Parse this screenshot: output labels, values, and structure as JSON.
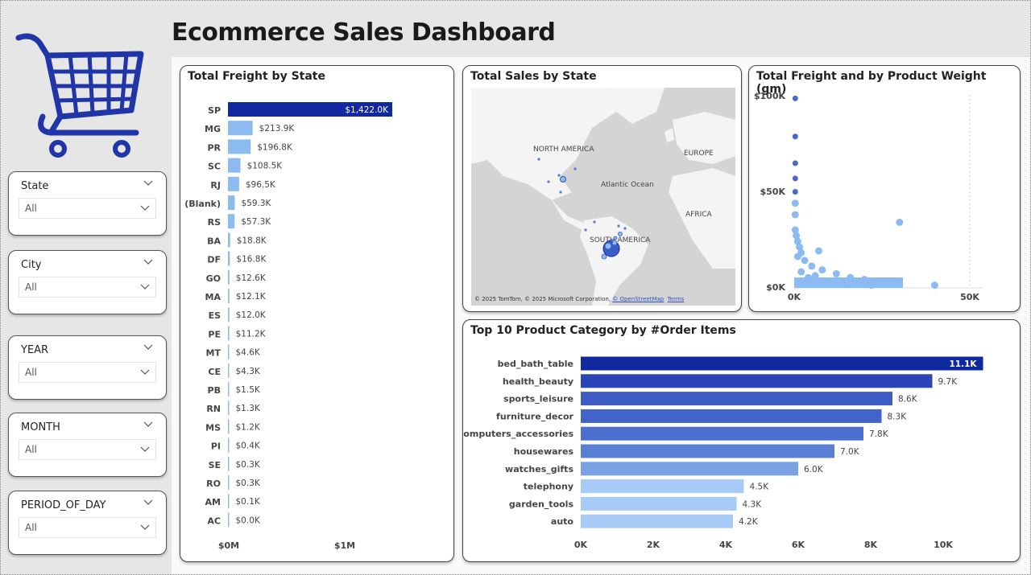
{
  "title": "Ecommerce Sales Dashboard",
  "colors": {
    "dark_blue": "#1129a0",
    "mid_blue": "#4a67cc",
    "light_blue": "#8bbbf0",
    "pale_blue": "#a7cbf6",
    "cart_blue": "#1f35a8"
  },
  "slicers": [
    {
      "label": "State",
      "value": "All"
    },
    {
      "label": "City",
      "value": "All"
    },
    {
      "label": "YEAR",
      "value": "All"
    },
    {
      "label": "MONTH",
      "value": "All"
    },
    {
      "label": "PERIOD_OF_DAY",
      "value": "All"
    }
  ],
  "freight_by_state": {
    "title": "Total Freight by State",
    "chart_data": {
      "type": "bar",
      "orientation": "horizontal",
      "categories": [
        "SP",
        "MG",
        "PR",
        "SC",
        "RJ",
        "(Blank)",
        "RS",
        "BA",
        "DF",
        "GO",
        "MA",
        "ES",
        "PE",
        "MT",
        "CE",
        "PB",
        "RN",
        "MS",
        "PI",
        "SE",
        "RO",
        "AM",
        "AC"
      ],
      "values": [
        1422.0,
        213.9,
        196.8,
        108.5,
        96.5,
        59.3,
        57.3,
        18.8,
        16.8,
        12.6,
        12.1,
        12.0,
        11.2,
        4.6,
        4.3,
        1.5,
        1.3,
        1.2,
        0.4,
        0.3,
        0.3,
        0.1,
        0.0
      ],
      "value_unit": "$K",
      "labels": [
        "$1,422.0K",
        "$213.9K",
        "$196.8K",
        "$108.5K",
        "$96.5K",
        "$59.3K",
        "$57.3K",
        "$18.8K",
        "$16.8K",
        "$12.6K",
        "$12.1K",
        "$12.0K",
        "$11.2K",
        "$4.6K",
        "$4.3K",
        "$1.5K",
        "$1.3K",
        "$1.2K",
        "$0.4K",
        "$0.3K",
        "$0.3K",
        "$0.1K",
        "$0.0K"
      ],
      "x_ticks": [
        "$0M",
        "$1M"
      ],
      "xlim": [
        0,
        1500
      ]
    }
  },
  "sales_by_state": {
    "title": "Total Sales by State",
    "labels": {
      "north_america": "NORTH AMERICA",
      "europe": "EUROPE",
      "atlantic": "Atlantic Ocean",
      "africa": "AFRICA",
      "south_america": "SOUTH AMERICA"
    },
    "credit": "© 2025 TomTom, © 2025 Microsoft Corporation,",
    "credit_link": "© OpenStreetMap",
    "terms": "Terms"
  },
  "freight_by_weight": {
    "title": "Total Freight and by Product Weight (gm)",
    "chart_data": {
      "type": "scatter",
      "y_ticks": [
        "$100K",
        "$50K",
        "$0K"
      ],
      "x_ticks": [
        "0K",
        "50K"
      ],
      "xlim": [
        0,
        55
      ],
      "ylim": [
        0,
        100
      ],
      "points": [
        {
          "x": 0.3,
          "y": 99
        },
        {
          "x": 0.3,
          "y": 79
        },
        {
          "x": 0.3,
          "y": 65
        },
        {
          "x": 0.3,
          "y": 57
        },
        {
          "x": 0.3,
          "y": 50
        },
        {
          "x": 0.3,
          "y": 44
        },
        {
          "x": 0.3,
          "y": 38
        },
        {
          "x": 0.3,
          "y": 30
        },
        {
          "x": 0.6,
          "y": 27
        },
        {
          "x": 1,
          "y": 24
        },
        {
          "x": 1.5,
          "y": 21
        },
        {
          "x": 2,
          "y": 18
        },
        {
          "x": 1,
          "y": 16
        },
        {
          "x": 3,
          "y": 14
        },
        {
          "x": 7,
          "y": 19
        },
        {
          "x": 30,
          "y": 34
        },
        {
          "x": 5,
          "y": 11
        },
        {
          "x": 8,
          "y": 9
        },
        {
          "x": 12,
          "y": 7
        },
        {
          "x": 6,
          "y": 6
        },
        {
          "x": 16,
          "y": 5
        },
        {
          "x": 20,
          "y": 4
        },
        {
          "x": 25,
          "y": 3
        },
        {
          "x": 30,
          "y": 2
        },
        {
          "x": 2,
          "y": 8
        },
        {
          "x": 4,
          "y": 5
        },
        {
          "x": 10,
          "y": 3
        },
        {
          "x": 15,
          "y": 2
        },
        {
          "x": 40,
          "y": 1
        },
        {
          "x": 1,
          "y": 3
        },
        {
          "x": 18,
          "y": 2
        },
        {
          "x": 22,
          "y": 1
        }
      ]
    }
  },
  "top_categories": {
    "title": "Top 10 Product Category by #Order Items",
    "chart_data": {
      "type": "bar",
      "orientation": "horizontal",
      "categories": [
        "bed_bath_table",
        "health_beauty",
        "sports_leisure",
        "furniture_decor",
        "computers_accessories",
        "housewares",
        "watches_gifts",
        "telephony",
        "garden_tools",
        "auto"
      ],
      "values": [
        11.1,
        9.7,
        8.6,
        8.3,
        7.8,
        7.0,
        6.0,
        4.5,
        4.3,
        4.2
      ],
      "value_unit": "K",
      "labels": [
        "11.1K",
        "9.7K",
        "8.6K",
        "8.3K",
        "7.8K",
        "7.0K",
        "6.0K",
        "4.5K",
        "4.3K",
        "4.2K"
      ],
      "x_ticks": [
        "0K",
        "2K",
        "4K",
        "6K",
        "8K",
        "10K"
      ],
      "xlim": [
        0,
        11.1
      ]
    }
  }
}
